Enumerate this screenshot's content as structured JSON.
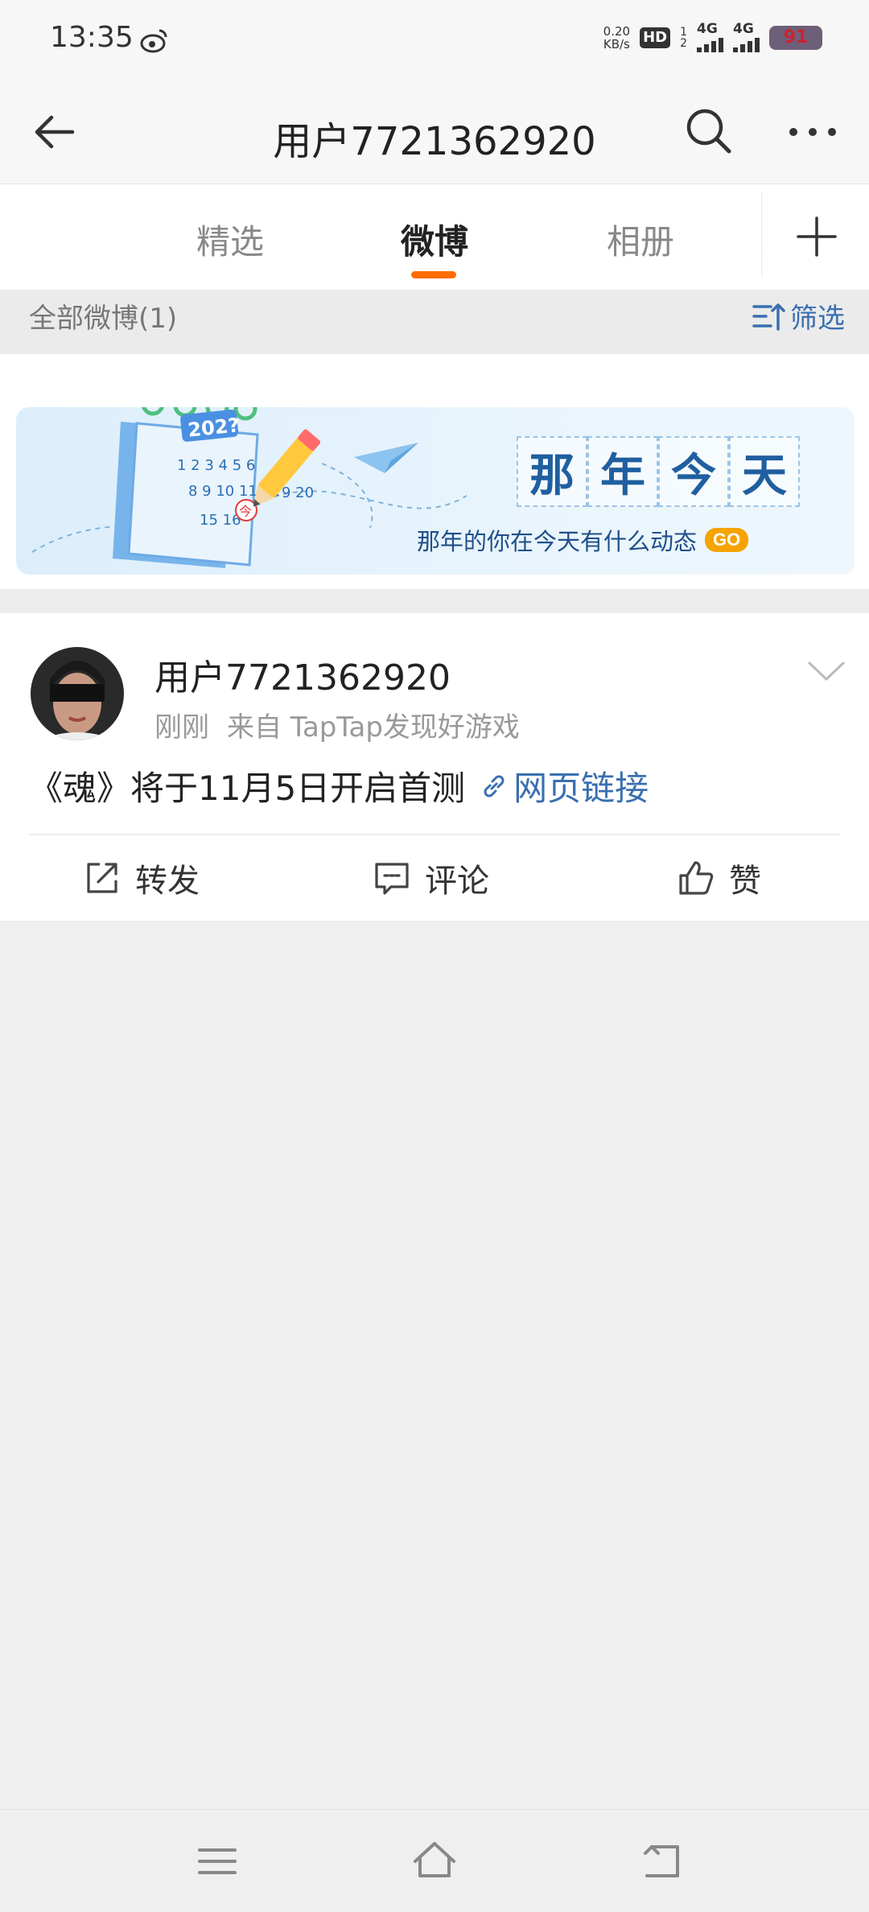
{
  "status_bar": {
    "time": "13:35",
    "net_speed_value": "0.20",
    "net_speed_unit": "KB/s",
    "hd_label": "HD",
    "sim1_label": "1",
    "sim2_label": "2",
    "network1": "4G",
    "network2": "4G",
    "battery": "91"
  },
  "nav": {
    "title": "用户7721362920"
  },
  "tabs": [
    {
      "label": "精选"
    },
    {
      "label": "微博"
    },
    {
      "label": "相册"
    }
  ],
  "filter": {
    "count_label": "全部微博(1)",
    "filter_label": "筛选"
  },
  "banner": {
    "title_chars": [
      "那",
      "年",
      "今",
      "天"
    ],
    "subtitle": "那年的你在今天有什么动态",
    "go_label": "GO",
    "calendar_year": "202?",
    "today_mark": "今"
  },
  "post": {
    "author": "用户7721362920",
    "time": "刚刚",
    "source": "来自 TapTap发现好游戏",
    "text": "《魂》将于11月5日开启首测",
    "link_label": "网页链接",
    "actions": {
      "repost": "转发",
      "comment": "评论",
      "like": "赞"
    }
  },
  "colors": {
    "accent": "#ff6d00",
    "link": "#3a6fb0",
    "go_badge": "#f5a300"
  }
}
